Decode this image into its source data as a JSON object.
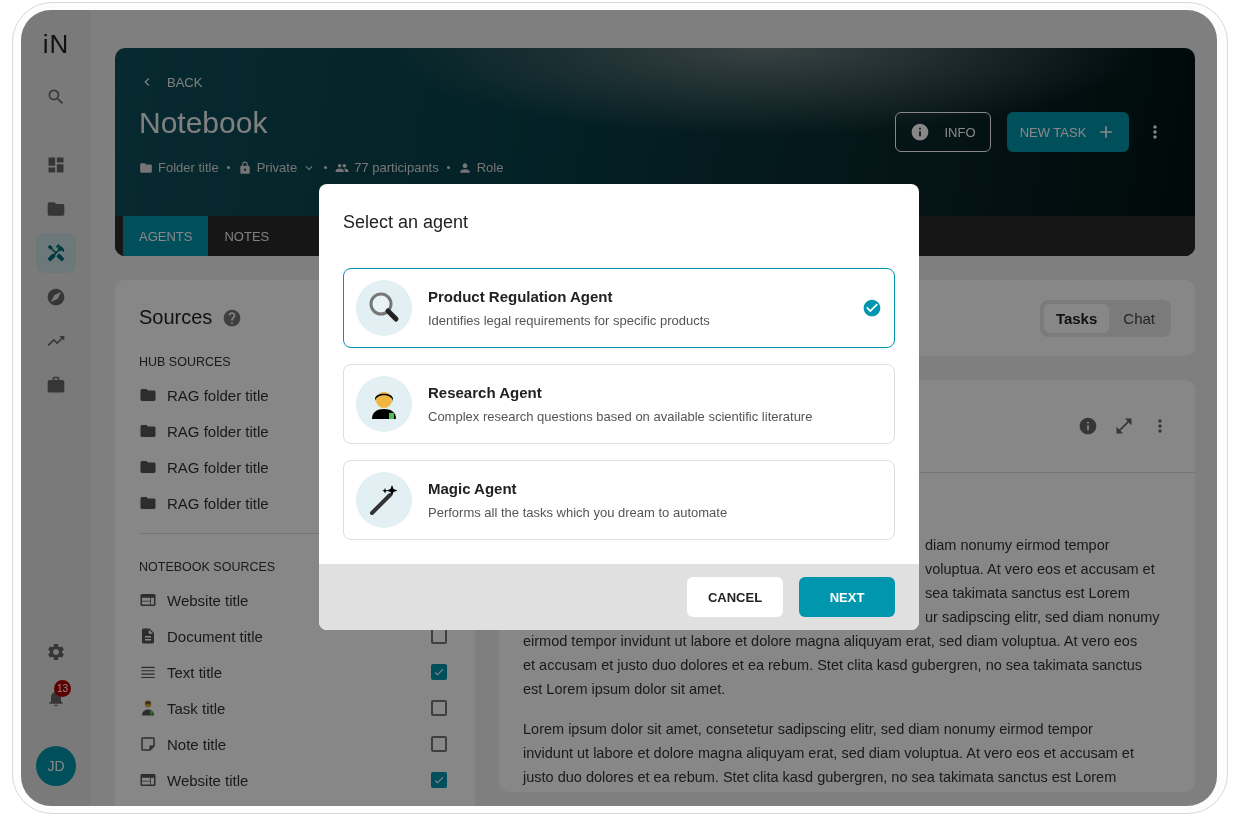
{
  "sidebar": {
    "logo": "iN",
    "nav_top": [
      {
        "kind": "search",
        "selected": false
      },
      {
        "kind": "dashboard",
        "selected": false
      },
      {
        "kind": "folder",
        "selected": false
      },
      {
        "kind": "tools",
        "selected": true
      },
      {
        "kind": "explore",
        "selected": false
      },
      {
        "kind": "trending",
        "selected": false
      },
      {
        "kind": "briefcase",
        "selected": false
      }
    ],
    "nav_bottom": [
      {
        "kind": "settings",
        "selected": false
      }
    ],
    "notifications": "13",
    "avatar": "JD"
  },
  "header": {
    "back": "BACK",
    "title": "Notebook",
    "meta": [
      {
        "kind": "folder",
        "text": "Folder title",
        "dropdown": false
      },
      {
        "kind": "lock",
        "text": "Private",
        "dropdown": true
      },
      {
        "kind": "people",
        "text": "77 participants",
        "dropdown": false
      },
      {
        "kind": "person",
        "text": "Role",
        "dropdown": false
      }
    ],
    "info_button": "INFO",
    "new_task_button": "NEW TASK",
    "tabs": [
      {
        "label": "AGENTS",
        "selected": true
      },
      {
        "label": "NOTES",
        "selected": false
      }
    ]
  },
  "sources": {
    "title": "Sources",
    "hub_heading": "HUB SOURCES",
    "hub_items": [
      {
        "label": "RAG folder title"
      },
      {
        "label": "RAG folder title"
      },
      {
        "label": "RAG folder title"
      },
      {
        "label": "RAG folder title"
      }
    ],
    "notebook_heading": "NOTEBOOK SOURCES",
    "notebook_items": [
      {
        "kind": "website",
        "label": "Website title"
      },
      {
        "kind": "document",
        "label": "Document title",
        "checked": false
      },
      {
        "kind": "text",
        "label": "Text title",
        "checked": true
      },
      {
        "kind": "task",
        "label": "Task title",
        "checked": false
      },
      {
        "kind": "note",
        "label": "Note title",
        "checked": false
      },
      {
        "kind": "website",
        "label": "Website title",
        "checked": true
      }
    ]
  },
  "view_toggle": [
    {
      "label": "Tasks",
      "selected": true
    },
    {
      "label": "Chat",
      "selected": false
    }
  ],
  "content": {
    "paragraphs": [
      {
        "lines": [
          {
            "kind": "partial",
            "text": "diam nonumy eirmod tempor"
          },
          {
            "kind": "partial",
            "text": "voluptua. At vero eos et accusam et"
          },
          {
            "kind": "partial",
            "text": "sea takimata sanctus est Lorem"
          },
          {
            "kind": "partial",
            "text": "ur sadipscing elitr, sed diam nonumy"
          },
          {
            "kind": "full",
            "text": "eirmod tempor invidunt ut labore et dolore magna aliquyam erat, sed diam voluptua. At vero eos"
          },
          {
            "kind": "full",
            "text": "et accusam et justo duo dolores et ea rebum. Stet clita kasd gubergren, no sea takimata sanctus"
          },
          {
            "kind": "full",
            "text": "est Lorem ipsum dolor sit amet."
          }
        ]
      },
      {
        "lines": [
          {
            "kind": "full",
            "text": "Lorem ipsum dolor sit amet, consetetur sadipscing elitr, sed diam nonumy eirmod tempor"
          },
          {
            "kind": "full",
            "text": "invidunt ut labore et dolore magna aliquyam erat, sed diam voluptua. At vero eos et accusam et"
          },
          {
            "kind": "full",
            "text": "justo duo dolores et ea rebum. Stet clita kasd gubergren, no sea takimata sanctus est Lorem"
          }
        ]
      }
    ]
  },
  "dialog": {
    "title": "Select an agent",
    "agents": [
      {
        "kind": "magnifier",
        "name": "Product Regulation Agent",
        "description": "Identifies legal requirements for specific products",
        "selected": true
      },
      {
        "kind": "scientist",
        "name": "Research Agent",
        "description": "Complex research questions based on available scientific literature",
        "selected": false
      },
      {
        "kind": "wand",
        "name": "Magic Agent",
        "description": "Performs all the tasks which you dream to automate",
        "selected": false
      }
    ],
    "buttons": [
      {
        "kind": "secondary",
        "label": "CANCEL"
      },
      {
        "kind": "primary",
        "label": "NEXT"
      }
    ]
  }
}
